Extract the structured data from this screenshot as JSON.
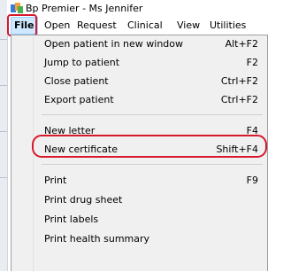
{
  "window": {
    "title": "Bp Premier - Ms Jennifer",
    "icon": "bp-premier-app-icon"
  },
  "menubar": {
    "items": [
      {
        "label": "File",
        "active": true
      },
      {
        "label": "Open"
      },
      {
        "label": "Request"
      },
      {
        "label": "Clinical"
      },
      {
        "label": "View"
      },
      {
        "label": "Utilities"
      }
    ]
  },
  "file_menu": {
    "items": [
      {
        "label": "Open patient in new window",
        "shortcut": "Alt+F2"
      },
      {
        "label": "Jump to patient",
        "shortcut": "F2"
      },
      {
        "label": "Close patient",
        "shortcut": "Ctrl+F2"
      },
      {
        "label": "Export patient",
        "shortcut": "Ctrl+F2"
      },
      {
        "label": "New letter",
        "shortcut": "F4"
      },
      {
        "label": "New certificate",
        "shortcut": "Shift+F4"
      },
      {
        "label": "Print",
        "shortcut": "F9"
      },
      {
        "label": "Print drug sheet",
        "shortcut": ""
      },
      {
        "label": "Print labels",
        "shortcut": ""
      },
      {
        "label": "Print health summary",
        "shortcut": ""
      }
    ]
  },
  "annotation": {
    "highlight_color": "#d7192e"
  }
}
